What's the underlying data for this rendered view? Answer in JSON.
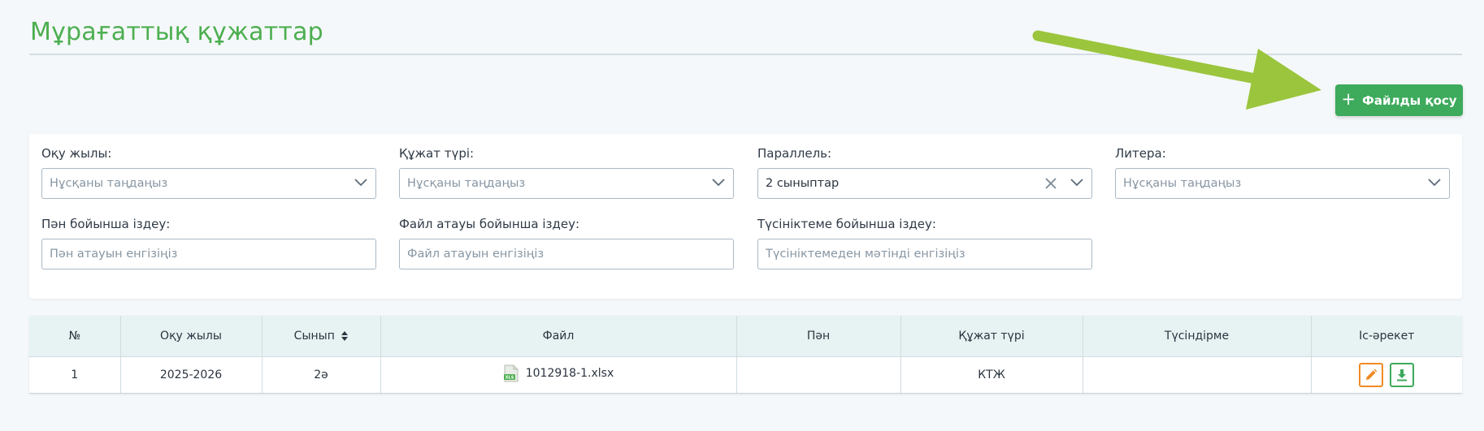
{
  "page": {
    "title": "Мұрағаттық құжаттар"
  },
  "toolbar": {
    "add_file_label": "Файлды қосу",
    "add_icon": "plus-icon"
  },
  "filters": {
    "year": {
      "label": "Оқу жылы:",
      "placeholder": "Нұсқаны таңдаңыз"
    },
    "doc_type": {
      "label": "Құжат түрі:",
      "placeholder": "Нұсқаны таңдаңыз"
    },
    "parallel": {
      "label": "Параллель:",
      "value": "2 сыныптар"
    },
    "litera": {
      "label": "Литера:",
      "placeholder": "Нұсқаны таңдаңыз"
    },
    "subject_search": {
      "label": "Пән бойынша іздеу:",
      "placeholder": "Пән атауын енгізіңіз"
    },
    "filename_search": {
      "label": "Файл атауы бойынша іздеу:",
      "placeholder": "Файл атауын енгізіңіз"
    },
    "comment_search": {
      "label": "Түсініктеме бойынша іздеу:",
      "placeholder": "Түсініктемеден мәтінді енгізіңіз"
    }
  },
  "table": {
    "headers": {
      "num": "№",
      "year": "Оқу жылы",
      "class": "Сынып",
      "file": "Файл",
      "subject": "Пән",
      "doc_type": "Құжат түрі",
      "comment": "Түсіндірме",
      "actions": "Іс-әрекет"
    },
    "rows": [
      {
        "num": "1",
        "year": "2025-2026",
        "class": "2ә",
        "file": "1012918-1.xlsx",
        "file_icon": "xls-file-icon",
        "subject": "",
        "doc_type": "КТЖ",
        "comment": ""
      }
    ]
  },
  "colors": {
    "accent_green": "#3daa5c",
    "title_green": "#4caf50",
    "edit_orange": "#f08a24",
    "annotation_arrow": "#9bc53d",
    "table_header_bg": "#e6f3f2"
  }
}
